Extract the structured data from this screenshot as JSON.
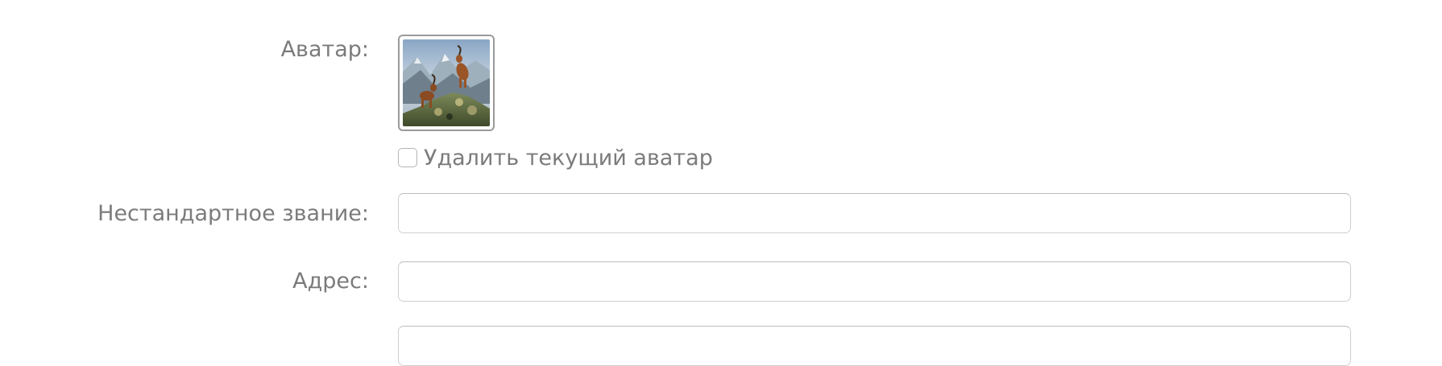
{
  "avatar": {
    "label": "Аватар:",
    "image": "mountain-goats-photo"
  },
  "delete_avatar": {
    "label": "Удалить текущий аватар",
    "checked": false
  },
  "custom_title": {
    "label": "Нестандартное звание:",
    "value": "",
    "placeholder": ""
  },
  "address": {
    "label": "Адрес:",
    "value": "",
    "placeholder": ""
  }
}
